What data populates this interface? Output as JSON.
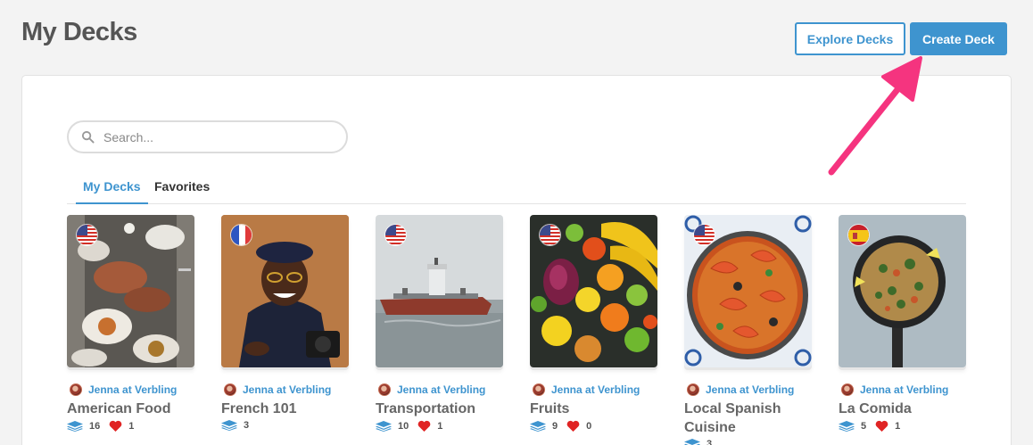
{
  "page": {
    "title": "My Decks"
  },
  "header": {
    "explore_label": "Explore Decks",
    "create_label": "Create Deck"
  },
  "search": {
    "placeholder": "Search..."
  },
  "tabs": [
    {
      "label": "My Decks",
      "active": true
    },
    {
      "label": "Favorites",
      "active": false
    }
  ],
  "decks": [
    {
      "title": "American Food",
      "author": "Jenna at Verbling",
      "flag": "us-flag-icon",
      "cards": "16",
      "likes": "1"
    },
    {
      "title": "French 101",
      "author": "Jenna at Verbling",
      "flag": "fr-flag-icon",
      "cards": "3",
      "likes": null
    },
    {
      "title": "Transportation",
      "author": "Jenna at Verbling",
      "flag": "us-flag-icon",
      "cards": "10",
      "likes": "1"
    },
    {
      "title": "Fruits",
      "author": "Jenna at Verbling",
      "flag": "us-flag-icon",
      "cards": "9",
      "likes": "0"
    },
    {
      "title": "Local Spanish Cuisine",
      "author": "Jenna at Verbling",
      "flag": "us-flag-icon",
      "cards": "3",
      "likes": null
    },
    {
      "title": "La Comida",
      "author": "Jenna at Verbling",
      "flag": "es-flag-icon",
      "cards": "5",
      "likes": "1"
    }
  ],
  "colors": {
    "accent": "#3e94cf",
    "heart": "#e02424",
    "annotation_arrow": "#f5347f"
  }
}
